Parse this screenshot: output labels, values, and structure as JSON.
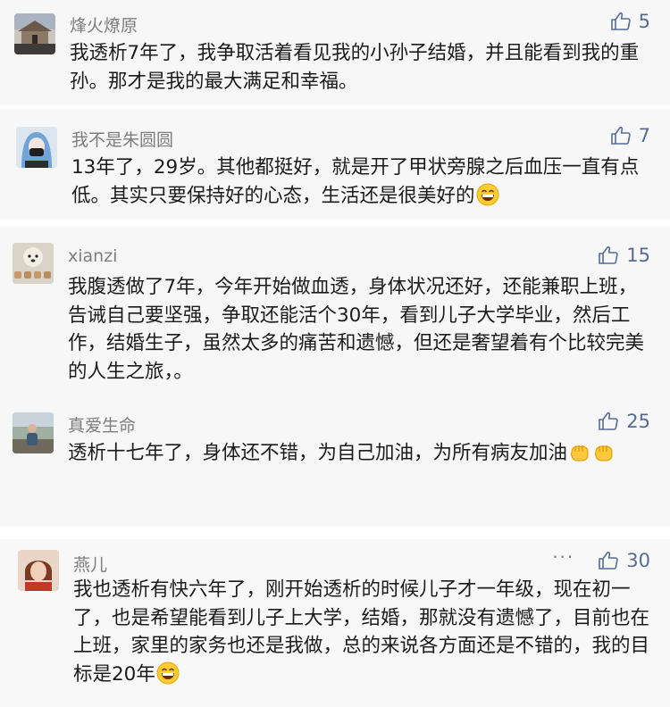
{
  "colors": {
    "card_bg": "#f7f7f7",
    "name_text": "#7d7d7d",
    "like_accent": "#576b95",
    "content_text": "#1b1b1b"
  },
  "comments": [
    {
      "name": "烽火燎原",
      "likes": "5",
      "avatar_icon": "building-landscape-photo",
      "content": "我透析7年了，我争取活着看见我的小孙子结婚，并且能看到我的重孙。那才是我的最大满足和幸福。"
    },
    {
      "name": "我不是朱圆圆",
      "likes": "7",
      "avatar_icon": "masked-person-illustration",
      "content": "13年了，29岁。其他都挺好，就是开了甲状旁腺之后血压一直有点低。其实只要保持好的心态，生活还是很美好的",
      "emoji": "grin-emoji"
    },
    {
      "name": "xianzi",
      "likes": "15",
      "avatar_icon": "dog-photo",
      "content": "我腹透做了7年，今年开始做血透，身体状况还好，还能兼职上班，告诫自己要坚强，争取还能活个30年，看到儿子大学毕业，然后工作，结婚生子，虽然太多的痛苦和遗憾，但还是奢望着有个比较完美的人生之旅，。"
    },
    {
      "name": "真爱生命",
      "likes": "25",
      "avatar_icon": "person-outdoor-photo",
      "content": "透析十七年了，身体还不错，为自己加油，为所有病友加油",
      "emoji": "raised-fist-emoji",
      "emoji_count": 2
    },
    {
      "name": "燕儿",
      "likes": "30",
      "avatar_icon": "woman-portrait-photo",
      "more_label": "···",
      "content": "我也透析有快六年了，刚开始透析的时候儿子才一年级，现在初一了，也是希望能看到儿子上大学，结婚，那就没有遗憾了，目前也在上班，家里的家务也还是我做，总的来说各方面还是不错的，我的目标是20年",
      "emoji": "grin-emoji"
    }
  ]
}
